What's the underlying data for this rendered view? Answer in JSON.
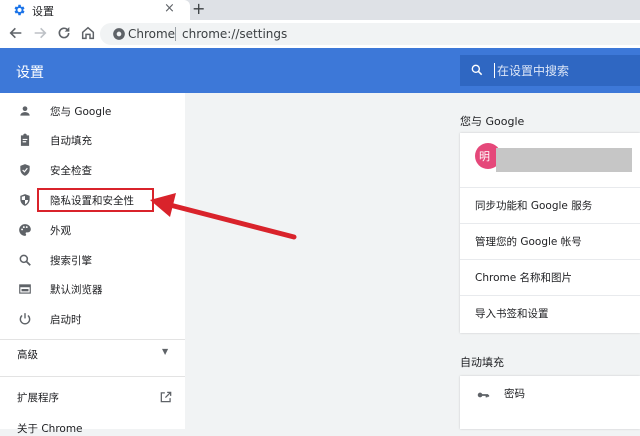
{
  "tab": {
    "title": "设置",
    "close": "×",
    "newtab": "+"
  },
  "address": {
    "site": "Chrome",
    "url": "chrome://settings"
  },
  "header": {
    "title": "设置",
    "search_placeholder": "在设置中搜索"
  },
  "sidebar": {
    "items": [
      {
        "label": "您与 Google",
        "icon": "person-icon"
      },
      {
        "label": "自动填充",
        "icon": "clipboard-icon"
      },
      {
        "label": "安全检查",
        "icon": "shield-check-icon"
      },
      {
        "label": "隐私设置和安全性",
        "icon": "shield-icon"
      },
      {
        "label": "外观",
        "icon": "palette-icon"
      },
      {
        "label": "搜索引擎",
        "icon": "search-icon"
      },
      {
        "label": "默认浏览器",
        "icon": "browser-icon"
      },
      {
        "label": "启动时",
        "icon": "power-icon"
      }
    ],
    "advanced": "高级",
    "extensions": "扩展程序",
    "about": "关于 Chrome"
  },
  "you_google": {
    "title": "您与 Google",
    "avatar": "明",
    "rows": [
      "同步功能和 Google 服务",
      "管理您的 Google 帐号",
      "Chrome 名称和图片",
      "导入书签和设置"
    ]
  },
  "autofill": {
    "title": "自动填充",
    "passwords": "密码"
  },
  "colors": {
    "header": "#3d78d8",
    "highlight": "#d9232b"
  }
}
